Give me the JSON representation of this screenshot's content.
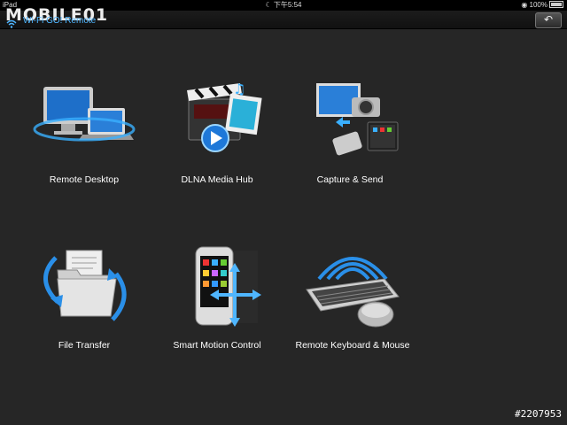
{
  "status_bar": {
    "device": "iPad",
    "time": "下午5:54",
    "battery": "100%"
  },
  "header": {
    "logo": "MOBILE01",
    "subtitle": "Wi-Fi GO! Remote",
    "back_icon": "undo-arrow-icon"
  },
  "tiles": [
    {
      "label": "Remote Desktop",
      "icon": "monitor-laptop-icon"
    },
    {
      "label": "DLNA Media Hub",
      "icon": "clapperboard-media-icon"
    },
    {
      "label": "Capture & Send",
      "icon": "camera-phone-icon"
    },
    {
      "label": "File Transfer",
      "icon": "folder-transfer-icon"
    },
    {
      "label": "Smart Motion Control",
      "icon": "phone-motion-icon"
    },
    {
      "label": "Remote Keyboard & Mouse",
      "icon": "keyboard-mouse-icon"
    }
  ],
  "watermark": "#2207953"
}
